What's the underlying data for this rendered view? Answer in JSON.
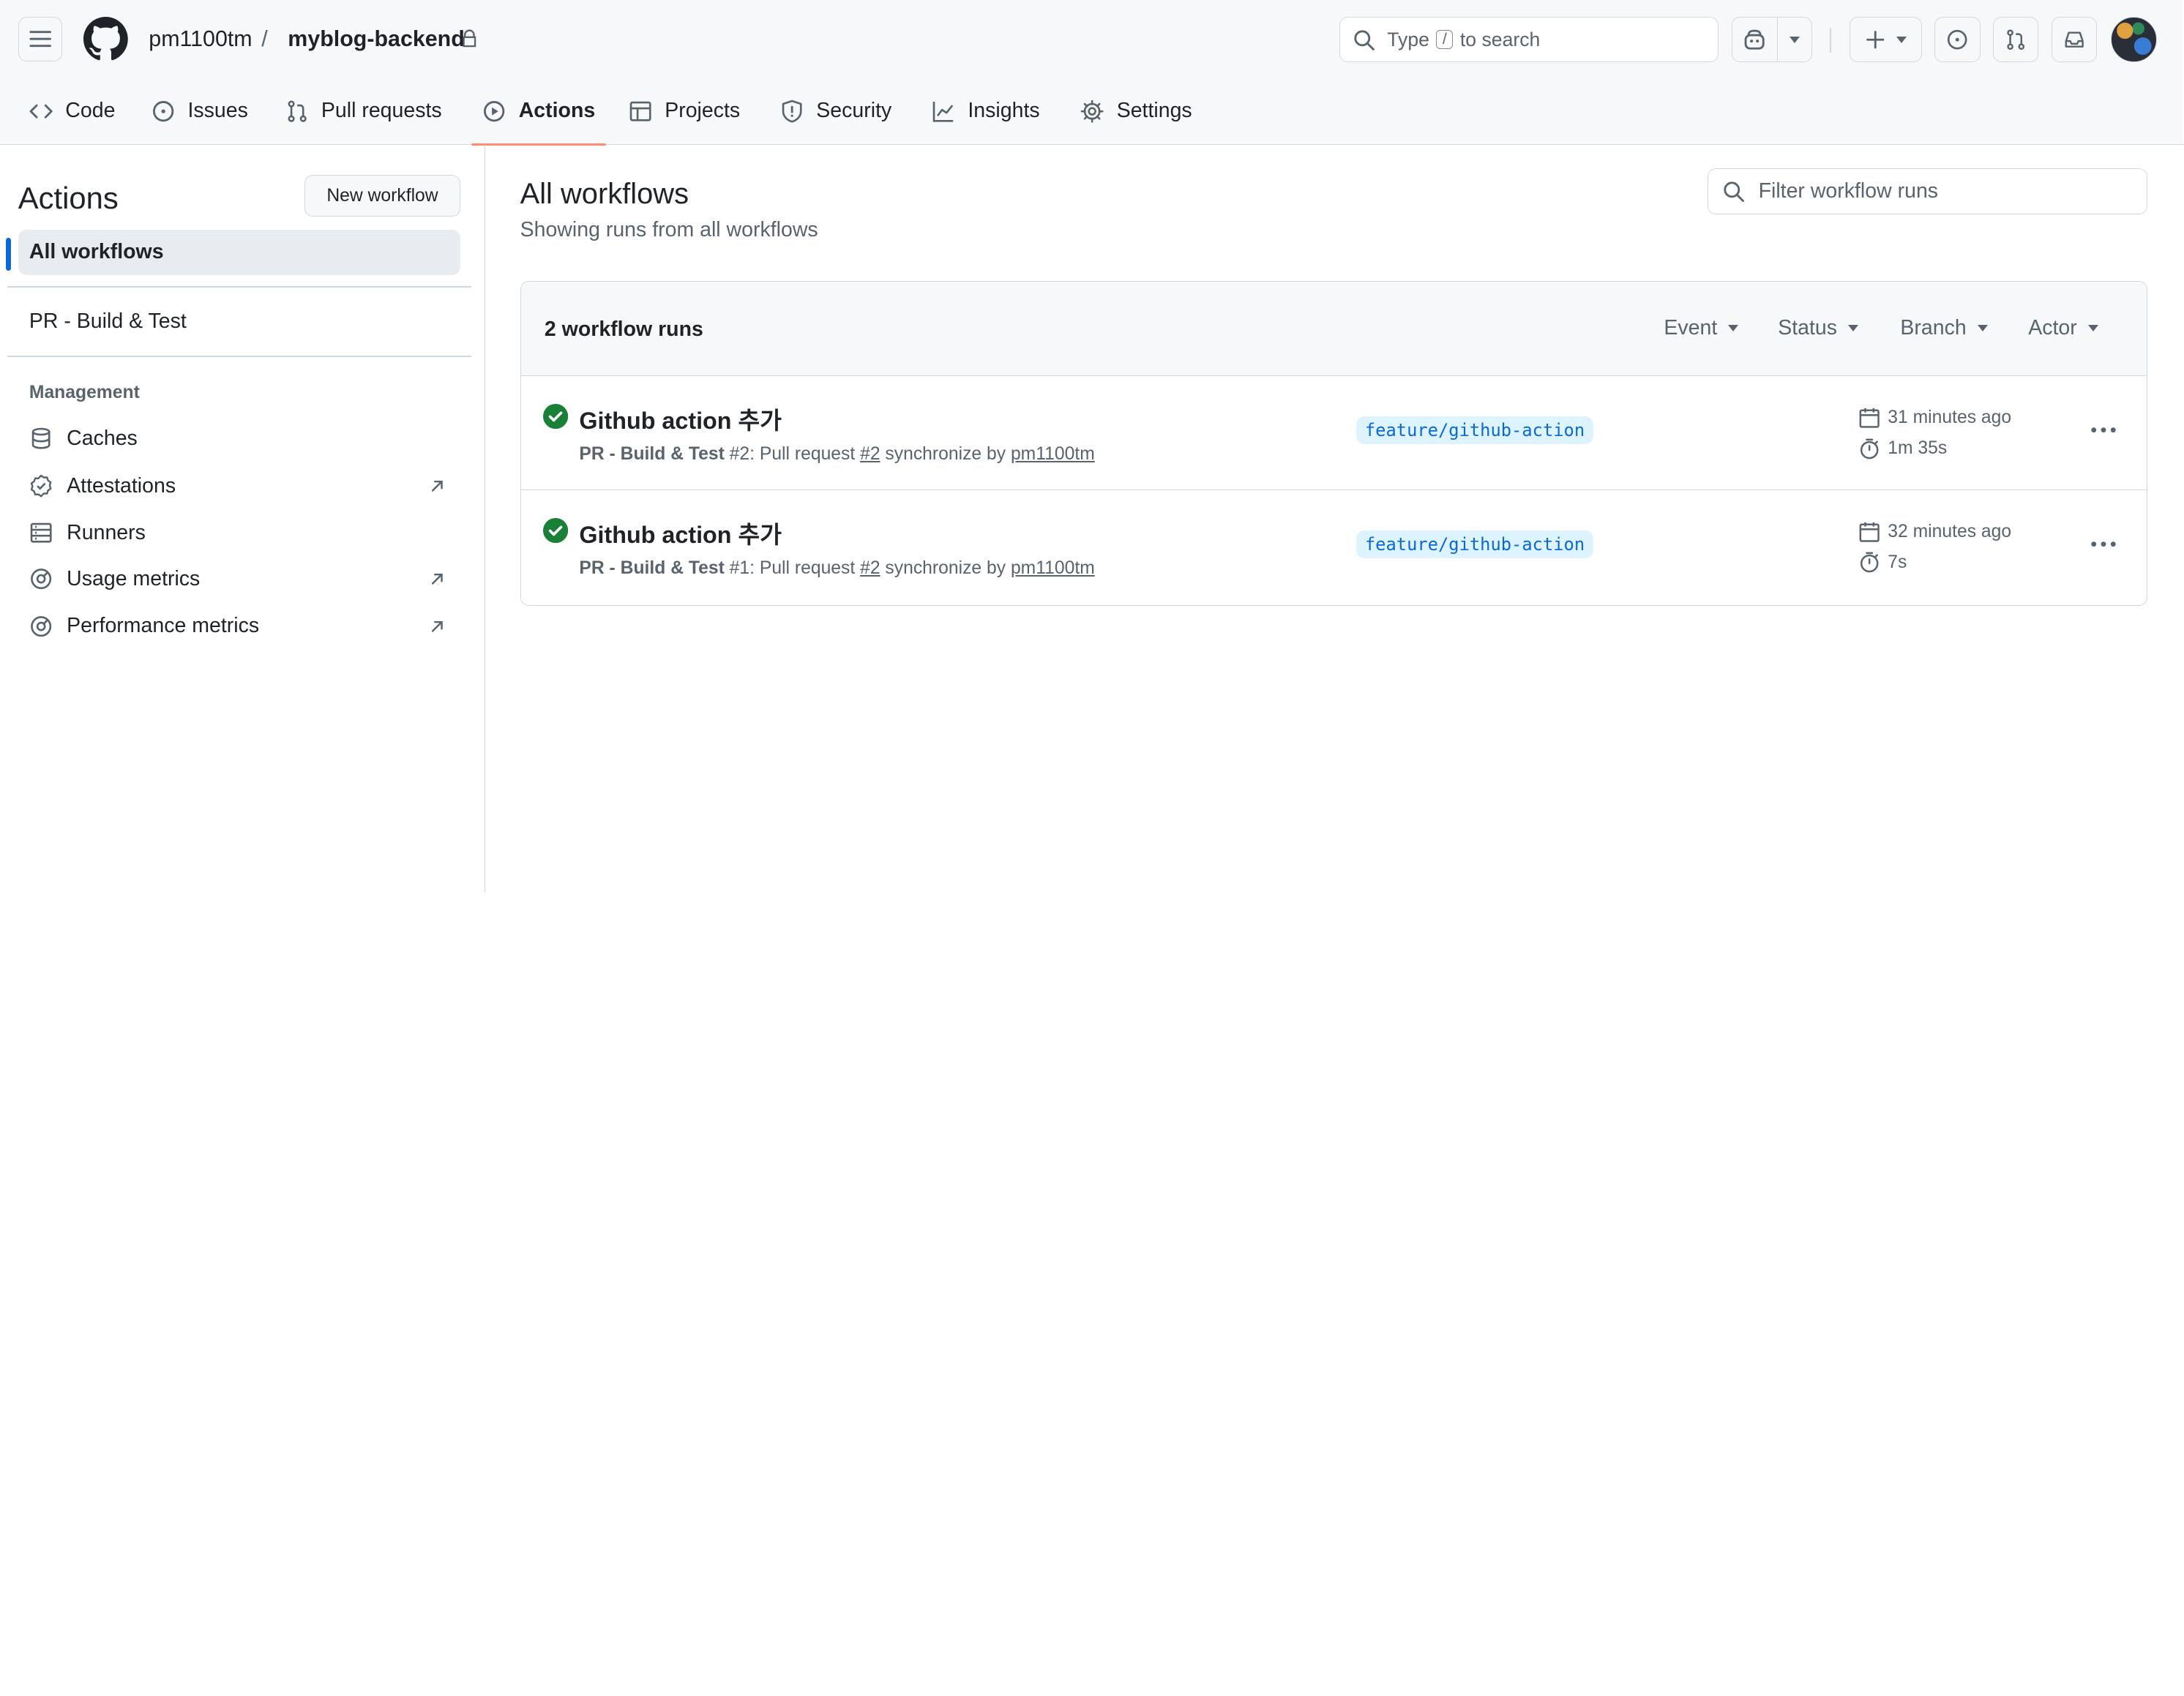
{
  "header": {
    "owner": "pm1100tm",
    "separator": "/",
    "repo": "myblog-backend",
    "search": {
      "before": "Type",
      "key": "/",
      "after": "to search"
    }
  },
  "repo_nav": [
    {
      "label": "Code",
      "icon": "code-icon"
    },
    {
      "label": "Issues",
      "icon": "issue-opened-icon"
    },
    {
      "label": "Pull requests",
      "icon": "git-pull-request-icon"
    },
    {
      "label": "Actions",
      "icon": "play-icon",
      "selected": true
    },
    {
      "label": "Projects",
      "icon": "table-icon"
    },
    {
      "label": "Security",
      "icon": "shield-icon"
    },
    {
      "label": "Insights",
      "icon": "graph-icon"
    },
    {
      "label": "Settings",
      "icon": "gear-icon"
    }
  ],
  "sidebar": {
    "title": "Actions",
    "new_workflow": "New workflow",
    "all_workflows": "All workflows",
    "workflows": [
      "PR - Build & Test"
    ],
    "management_heading": "Management",
    "management": [
      {
        "label": "Caches",
        "icon": "database-icon"
      },
      {
        "label": "Attestations",
        "icon": "verified-icon",
        "external": true
      },
      {
        "label": "Runners",
        "icon": "server-icon"
      },
      {
        "label": "Usage metrics",
        "icon": "meter-icon",
        "external": true
      },
      {
        "label": "Performance metrics",
        "icon": "meter-icon",
        "external": true
      }
    ]
  },
  "main": {
    "title": "All workflows",
    "subtitle": "Showing runs from all workflows",
    "filter_placeholder": "Filter workflow runs",
    "runs_count": "2 workflow runs",
    "filters": [
      "Event",
      "Status",
      "Branch",
      "Actor"
    ],
    "runs": [
      {
        "title": "Github action 추가",
        "workflow": "PR - Build & Test",
        "number": "#2",
        "event_text": ": Pull request",
        "pr": "#2",
        "action": "synchronize by",
        "actor": "pm1100tm",
        "branch": "feature/github-action",
        "when": "31 minutes ago",
        "duration": "1m 35s",
        "status": "success"
      },
      {
        "title": "Github action 추가",
        "workflow": "PR - Build & Test",
        "number": "#1",
        "event_text": ": Pull request",
        "pr": "#2",
        "action": "synchronize by",
        "actor": "pm1100tm",
        "branch": "feature/github-action",
        "when": "32 minutes ago",
        "duration": "7s",
        "status": "success"
      }
    ]
  },
  "colors": {
    "accent": "#0969da",
    "success": "#1a7f37",
    "tab_underline": "#fd8c73",
    "muted": "#59636e"
  }
}
